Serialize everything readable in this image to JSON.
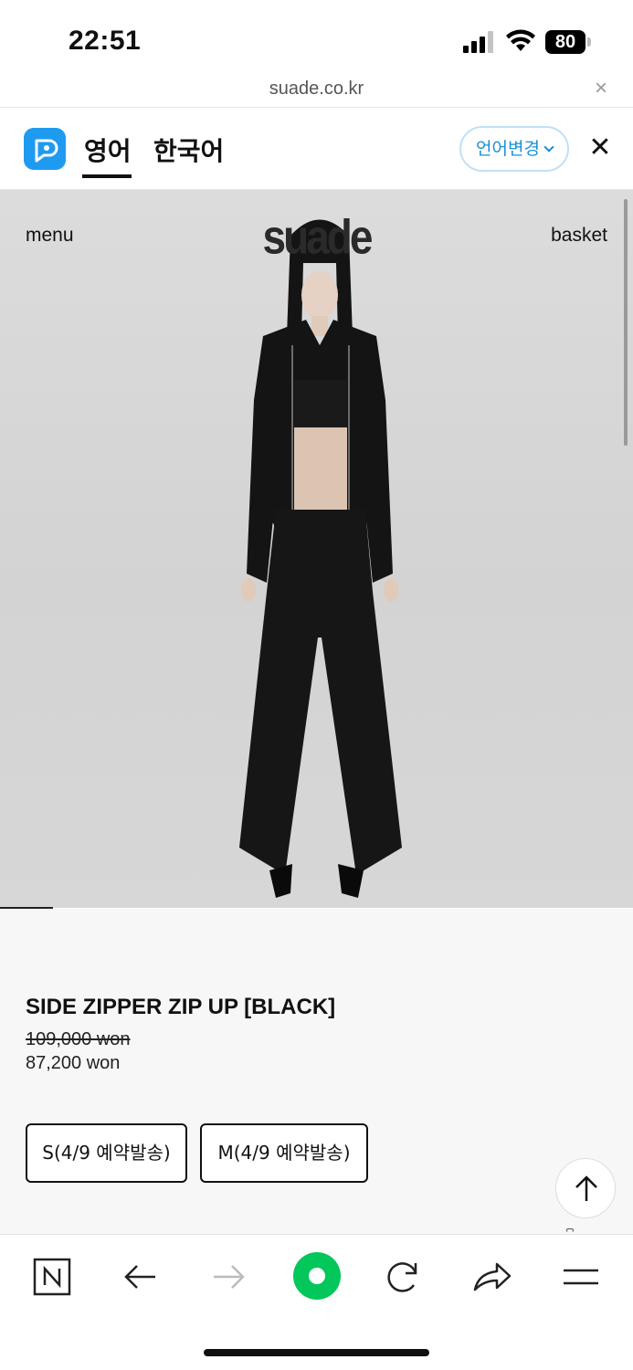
{
  "status_bar": {
    "time": "22:51",
    "battery": "80"
  },
  "url_bar": {
    "url": "suade.co.kr"
  },
  "translation_bar": {
    "lang_source": "영어",
    "lang_target": "한국어",
    "change_label": "언어변경"
  },
  "site_header": {
    "menu_label": "menu",
    "logo_text": "suade",
    "basket_label": "basket"
  },
  "product": {
    "title": "SIDE ZIPPER ZIP UP [BLACK]",
    "original_price": "109,000 won",
    "sale_price": "87,200 won",
    "options": [
      {
        "label": "S(4/9 예약발송)"
      },
      {
        "label": "M(4/9 예약발송)"
      }
    ]
  },
  "toolbar": {
    "items": [
      "naver-home",
      "back",
      "forward",
      "green-dot",
      "reload",
      "share",
      "menu"
    ]
  },
  "colors": {
    "accent_blue": "#1e9bf0",
    "green": "#03c75a"
  }
}
